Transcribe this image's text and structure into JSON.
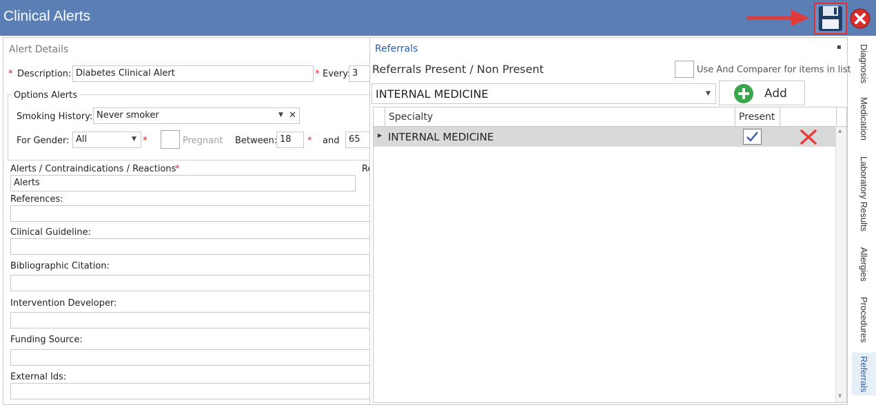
{
  "window": {
    "title": "Clinical Alerts"
  },
  "alert_details": {
    "section_title": "Alert Details",
    "description_label": "Description:",
    "description_value": "Diabetes Clinical Alert",
    "every_label": "Every:",
    "every_value": "3",
    "options_title": "Options Alerts",
    "smoking_label": "Smoking History:",
    "smoking_value": "Never smoker",
    "gender_label": "For Gender:",
    "gender_value": "All",
    "pregnant_label": "Pregnant",
    "between_label": "Between:",
    "between_from": "18",
    "and_label": "and",
    "between_to": "65",
    "alerts_label": "Alerts / Contraindications / Reactions",
    "alerts_value": "Alerts",
    "cutoff_label": "Re",
    "references_label": "References:",
    "guideline_label": "Clinical Guideline:",
    "citation_label": "Bibliographic Citation:",
    "developer_label": "Intervention Developer:",
    "funding_label": "Funding Source:",
    "external_label": "External Ids:"
  },
  "referrals": {
    "panel_title": "Referrals",
    "subtitle": "Referrals Present / Non Present",
    "comparer_label": "Use And Comparer for items in list",
    "dropdown_value": "INTERNAL MEDICINE",
    "add_label": "Add",
    "columns": [
      "Specialty",
      "Present"
    ],
    "rows": [
      {
        "specialty": "INTERNAL MEDICINE",
        "present": true
      }
    ]
  },
  "side_tabs": [
    {
      "label": "Diagnosis",
      "active": false
    },
    {
      "label": "Medication",
      "active": false
    },
    {
      "label": "Laboratory Results",
      "active": false
    },
    {
      "label": "Allergies",
      "active": false
    },
    {
      "label": "Procedures",
      "active": false
    },
    {
      "label": "Referrals",
      "active": true
    }
  ],
  "colors": {
    "titlebar": "#5b7fb5",
    "required": "#e02020",
    "add_icon": "#3aa64b",
    "delete_icon": "#e83b3b",
    "active_tab_text": "#2b5ea8"
  },
  "icons": {
    "save": "floppy-disk-icon",
    "close": "close-circle-icon",
    "add": "plus-circle-icon",
    "delete": "x-icon",
    "check": "checkmark-icon"
  }
}
